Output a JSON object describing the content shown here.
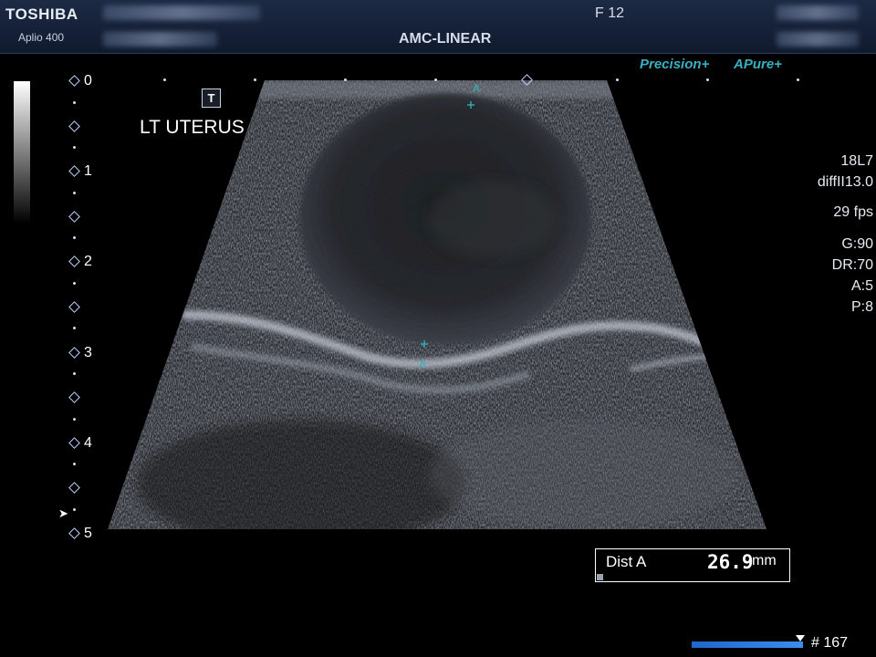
{
  "header": {
    "brand": "TOSHIBA",
    "model": "Aplio 400",
    "frame_label": "F  12",
    "probe_title": "AMC-LINEAR"
  },
  "logos": {
    "precision": "Precision+",
    "apure": "APure+"
  },
  "image": {
    "t_marker": "T",
    "body_mark": "LT UTERUS",
    "caliper_label": "A",
    "caliper_color": "#2fb8c0"
  },
  "depth_scale": {
    "labels": [
      "0",
      "1",
      "2",
      "3",
      "4",
      "5"
    ],
    "unit": "cm"
  },
  "params": {
    "probe": "18L7",
    "mode": "diffII13.0",
    "fps": "29 fps",
    "gain": "G:90",
    "dynamic_range": "DR:70",
    "acoustic": "A:5",
    "persistence": "P:8"
  },
  "measurement": {
    "label": "Dist A",
    "value": "26.9",
    "unit": "mm"
  },
  "cine": {
    "counter": "# 167"
  },
  "colors": {
    "header_bg": "#1c2a44",
    "accent_teal": "#39b0bf",
    "cine_bar": "#1e66cc"
  }
}
